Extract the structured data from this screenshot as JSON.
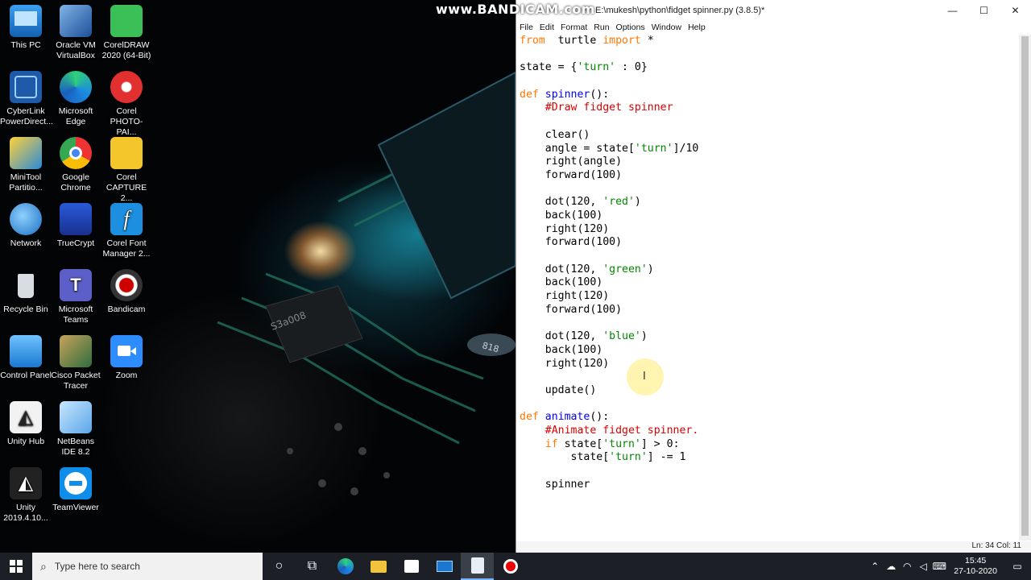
{
  "watermark": "www.BANDICAM.com",
  "window": {
    "title": "E:\\mukesh\\python\\fidget spinner.py (3.8.5)*",
    "minimize": "—",
    "maximize": "☐",
    "close": "✕"
  },
  "menu": [
    "File",
    "Edit",
    "Format",
    "Run",
    "Options",
    "Window",
    "Help"
  ],
  "status": "Ln: 34  Col: 11",
  "desktop_icons": [
    {
      "label": "This PC"
    },
    {
      "label": "Oracle VM VirtualBox"
    },
    {
      "label": "CorelDRAW 2020 (64-Bit)"
    },
    {
      "label": "CyberLink PowerDirect..."
    },
    {
      "label": "Microsoft Edge"
    },
    {
      "label": "Corel PHOTO-PAI..."
    },
    {
      "label": "MiniTool Partitio..."
    },
    {
      "label": "Google Chrome"
    },
    {
      "label": "Corel CAPTURE 2..."
    },
    {
      "label": "Network"
    },
    {
      "label": "TrueCrypt"
    },
    {
      "label": "Corel Font Manager 2..."
    },
    {
      "label": "Recycle Bin"
    },
    {
      "label": "Microsoft Teams"
    },
    {
      "label": "Bandicam"
    },
    {
      "label": "Control Panel"
    },
    {
      "label": "Cisco Packet Tracer"
    },
    {
      "label": "Zoom"
    },
    {
      "label": "Unity Hub"
    },
    {
      "label": "NetBeans IDE 8.2"
    },
    {
      "label": "Unity 2019.4.10..."
    },
    {
      "label": "TeamViewer"
    }
  ],
  "taskbar": {
    "search_placeholder": "Type here to search",
    "time": "15:45",
    "date": "27-10-2020"
  },
  "code": [
    [
      [
        "kw",
        "from"
      ],
      [
        "",
        "  turtle "
      ],
      [
        "kw",
        "import"
      ],
      [
        "",
        " *"
      ]
    ],
    [],
    [
      [
        "",
        "state = {"
      ],
      [
        "str",
        "'turn'"
      ],
      [
        "",
        " : 0}"
      ]
    ],
    [],
    [
      [
        "kw",
        "def"
      ],
      [
        "",
        " "
      ],
      [
        "fn",
        "spinner"
      ],
      [
        "",
        "():"
      ]
    ],
    [
      [
        "",
        "    "
      ],
      [
        "cm",
        "#Draw fidget spinner"
      ]
    ],
    [],
    [
      [
        "",
        "    clear()"
      ]
    ],
    [
      [
        "",
        "    angle = state["
      ],
      [
        "str",
        "'turn'"
      ],
      [
        "",
        "]/10"
      ]
    ],
    [
      [
        "",
        "    right(angle)"
      ]
    ],
    [
      [
        "",
        "    forward(100)"
      ]
    ],
    [],
    [
      [
        "",
        "    dot(120, "
      ],
      [
        "str",
        "'red'"
      ],
      [
        "",
        ")"
      ]
    ],
    [
      [
        "",
        "    back(100)"
      ]
    ],
    [
      [
        "",
        "    right(120)"
      ]
    ],
    [
      [
        "",
        "    forward(100)"
      ]
    ],
    [],
    [
      [
        "",
        "    dot(120, "
      ],
      [
        "str",
        "'green'"
      ],
      [
        "",
        ")"
      ]
    ],
    [
      [
        "",
        "    back(100)"
      ]
    ],
    [
      [
        "",
        "    right(120)"
      ]
    ],
    [
      [
        "",
        "    forward(100)"
      ]
    ],
    [],
    [
      [
        "",
        "    dot(120, "
      ],
      [
        "str",
        "'blue'"
      ],
      [
        "",
        ")"
      ]
    ],
    [
      [
        "",
        "    back(100)"
      ]
    ],
    [
      [
        "",
        "    right(120)"
      ]
    ],
    [],
    [
      [
        "",
        "    update()"
      ]
    ],
    [],
    [
      [
        "kw",
        "def"
      ],
      [
        "",
        " "
      ],
      [
        "fn",
        "animate"
      ],
      [
        "",
        "():"
      ]
    ],
    [
      [
        "",
        "    "
      ],
      [
        "cm",
        "#Animate fidget spinner."
      ]
    ],
    [
      [
        "",
        "    "
      ],
      [
        "kw",
        "if"
      ],
      [
        "",
        " state["
      ],
      [
        "str",
        "'turn'"
      ],
      [
        "",
        "] > 0:"
      ]
    ],
    [
      [
        "",
        "        state["
      ],
      [
        "str",
        "'turn'"
      ],
      [
        "",
        "] -= 1"
      ]
    ],
    [],
    [
      [
        "",
        "    spinner"
      ]
    ]
  ]
}
